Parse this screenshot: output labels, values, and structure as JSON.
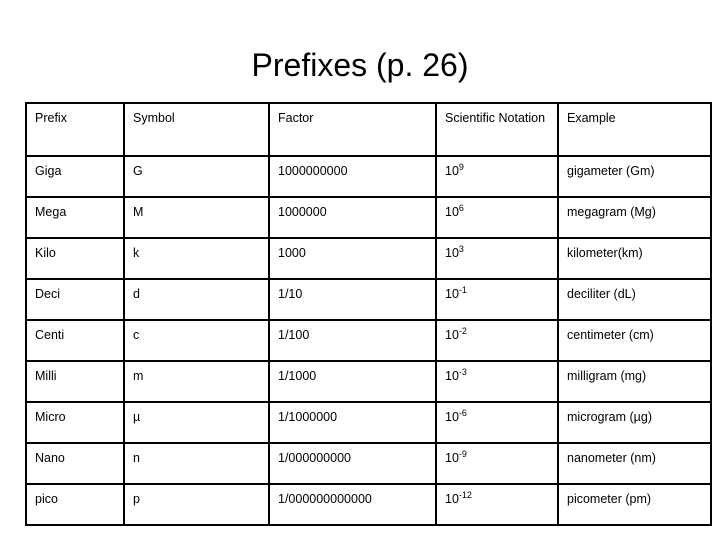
{
  "slide": {
    "title": "Prefixes (p. 26)"
  },
  "table": {
    "headers": [
      "Prefix",
      "Symbol",
      "Factor",
      "Scientific Notation",
      "Example"
    ],
    "rows": [
      {
        "prefix": "Giga",
        "symbol": "G",
        "factor": "1000000000",
        "sci_base": "10",
        "sci_exponent": "9",
        "example": "gigameter (Gm)"
      },
      {
        "prefix": "Mega",
        "symbol": "M",
        "factor": "1000000",
        "sci_base": "10",
        "sci_exponent": "6",
        "example": "megagram (Mg)"
      },
      {
        "prefix": "Kilo",
        "symbol": "k",
        "factor": "1000",
        "sci_base": "10",
        "sci_exponent": "3",
        "example": "kilometer(km)"
      },
      {
        "prefix": "Deci",
        "symbol": "d",
        "factor": "1/10",
        "sci_base": "10",
        "sci_exponent": "-1",
        "example": "deciliter (dL)"
      },
      {
        "prefix": "Centi",
        "symbol": "c",
        "factor": "1/100",
        "sci_base": "10",
        "sci_exponent": "-2",
        "example": "centimeter (cm)"
      },
      {
        "prefix": "Milli",
        "symbol": "m",
        "factor": "1/1000",
        "sci_base": "10",
        "sci_exponent": "-3",
        "example": "milligram (mg)"
      },
      {
        "prefix": "Micro",
        "symbol": "µ",
        "factor": "1/1000000",
        "sci_base": "10",
        "sci_exponent": "-6",
        "example": "microgram (µg)"
      },
      {
        "prefix": "Nano",
        "symbol": "n",
        "factor": "1/000000000",
        "sci_base": "10",
        "sci_exponent": "-9",
        "example": "nanometer (nm)"
      },
      {
        "prefix": "pico",
        "symbol": "p",
        "factor": "1/000000000000",
        "sci_base": "10",
        "sci_exponent": "-12",
        "example": "picometer (pm)"
      }
    ]
  }
}
